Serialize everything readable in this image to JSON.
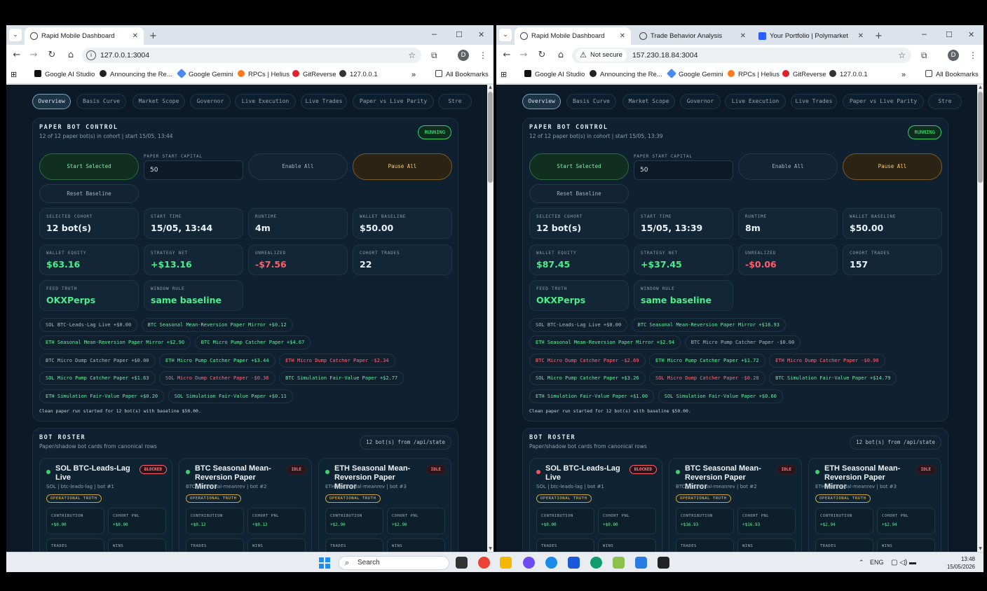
{
  "browser": {
    "left": {
      "tabs": [
        {
          "title": "Rapid Mobile Dashboard",
          "active": true
        }
      ],
      "url": "127.0.0.1:3004",
      "avatar": "D"
    },
    "right": {
      "tabs": [
        {
          "title": "Rapid Mobile Dashboard",
          "active": true
        },
        {
          "title": "Trade Behavior Analysis",
          "active": false
        },
        {
          "title": "Your Portfolio | Polymarket",
          "active": false
        }
      ],
      "not_secure": "Not secure",
      "url": "157.230.18.84:3004",
      "avatar": "D"
    },
    "bookmarks": [
      "Google AI Studio",
      "Announcing the Re...",
      "Google Gemini",
      "RPCs | Helius",
      "GitReverse",
      "127.0.0.1"
    ],
    "more": "»",
    "all_bookmarks": "All Bookmarks"
  },
  "nav_tabs": [
    "Overview",
    "Basis Curve",
    "Market Scope",
    "Governor",
    "Live Execution",
    "Live Trades",
    "Paper vs Live Parity",
    "Stre"
  ],
  "control": {
    "title": "PAPER BOT CONTROL",
    "running": "RUNNING",
    "start_selected": "Start Selected",
    "capital_label": "PAPER START CAPITAL",
    "capital_value": "50",
    "enable_all": "Enable All",
    "pause_all": "Pause All",
    "reset_baseline": "Reset Baseline",
    "stat_labels": [
      "SELECTED COHORT",
      "START TIME",
      "RUNTIME",
      "WALLET BASELINE",
      "WALLET EQUITY",
      "STRATEGY NET",
      "UNREALIZED",
      "COHORT TRADES",
      "FEED TRUTH",
      "WINDOW RULE"
    ]
  },
  "roster": {
    "title": "BOT ROSTER",
    "subtitle": "Paper/shadow bot cards from canonical rows",
    "badge": "12 bot(s) from /api/state",
    "op_truth": "OPERATIONAL TRUTH",
    "contribution": "CONTRIBUTION",
    "cohort_pnl": "COHORT PNL",
    "trades": "TRADES",
    "wins": "WINS",
    "cards": [
      {
        "name": "SOL BTC-Leads-Lag Live",
        "sub": "SOL | btc-leads-lag | bot #1",
        "badge": "BLOCKED"
      },
      {
        "name": "BTC Seasonal Mean-Reversion Paper Mirror",
        "sub": "BTC | seasonal-meanrev | bot #2",
        "badge": "IDLE"
      },
      {
        "name": "ETH Seasonal Mean-Reversion Paper Mirror",
        "sub": "ETH | seasonal-meanrev | bot #3",
        "badge": "IDLE"
      }
    ]
  },
  "dash_left": {
    "subtitle": "12 of 12 paper bot(s) in cohort | start 15/05, 13:44",
    "stats": [
      "12 bot(s)",
      "15/05, 13:44",
      "4m",
      "$50.00",
      "$63.16",
      "+$13.16",
      "-$7.56",
      "22",
      "OKXPerps",
      "same baseline"
    ],
    "chips": [
      [
        "SOL BTC-Leads-Lag Live +$0.00",
        "BTC Seasonal Mean-Reversion Paper Mirror +$0.12"
      ],
      [
        "ETH Seasonal Mean-Reversion Paper Mirror +$2.90",
        "BTC Micro Pump Catcher Paper +$4.67"
      ],
      [
        "BTC Micro Dump Catcher Paper +$0.00",
        "ETH Micro Pump Catcher Paper +$3.44",
        "ETH Micro Dump Catcher Paper -$2.34"
      ],
      [
        "SOL Micro Pump Catcher Paper +$1.63",
        "SOL Micro Dump Catcher Paper -$0.36",
        "BTC Simulation Fair-Value Paper +$2.77"
      ],
      [
        "ETH Simulation Fair-Value Paper +$0.20",
        "SOL Simulation Fair-Value Paper +$0.11"
      ]
    ],
    "note": "Clean paper run started for 12 bot(s) with baseline $50.00.",
    "card_values": [
      [
        "+$0.00",
        "+$0.00"
      ],
      [
        "+$0.12",
        "+$0.12"
      ],
      [
        "+$2.90",
        "+$2.90"
      ]
    ]
  },
  "dash_right": {
    "subtitle": "12 of 12 paper bot(s) in cohort | start 15/05, 13:39",
    "stats": [
      "12 bot(s)",
      "15/05, 13:39",
      "8m",
      "$50.00",
      "$87.45",
      "+$37.45",
      "-$0.06",
      "157",
      "OKXPerps",
      "same baseline"
    ],
    "chips": [
      [
        "SOL BTC-Leads-Lag Live +$0.00",
        "BTC Seasonal Mean-Reversion Paper Mirror +$16.93"
      ],
      [
        "ETH Seasonal Mean-Reversion Paper Mirror +$2.94",
        "BTC Micro Pump Catcher Paper -$0.00"
      ],
      [
        "BTC Micro Dump Catcher Paper -$2.69",
        "ETH Micro Pump Catcher Paper +$1.72",
        "ETH Micro Dump Catcher Paper -$0.90"
      ],
      [
        "SOL Micro Pump Catcher Paper +$3.26",
        "SOL Micro Dump Catcher Paper -$0.28",
        "BTC Simulation Fair-Value Paper +$14.79"
      ],
      [
        "ETH Simulation Fair-Value Paper +$1.00",
        "SOL Simulation Fair-Value Paper +$0.60"
      ]
    ],
    "note": "Clean paper run started for 12 bot(s) with baseline $50.00.",
    "card_values": [
      [
        "+$0.00",
        "+$0.00"
      ],
      [
        "+$16.93",
        "+$16.93"
      ],
      [
        "+$2.94",
        "+$2.94"
      ]
    ]
  },
  "taskbar": {
    "search": "Search",
    "lang": "ENG",
    "time": "13:48",
    "date": "15/05/2026"
  },
  "colors": {
    "positive": "#49f08a",
    "negative": "#ff5f6a",
    "dashboard_bg": "#0b1a26"
  }
}
